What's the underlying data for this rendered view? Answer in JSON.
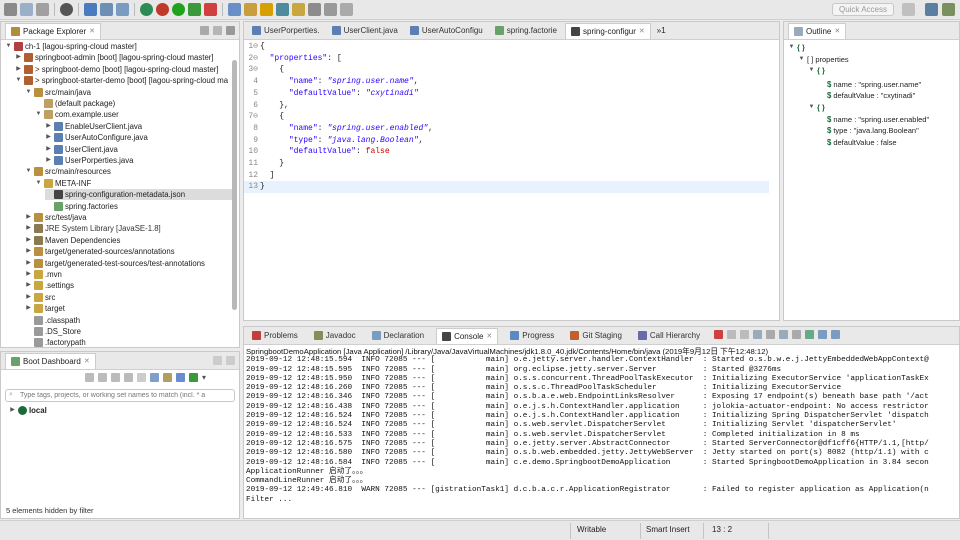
{
  "toolbar": {
    "quick_access": "Quick Access"
  },
  "package_explorer": {
    "title": "Package Explorer",
    "items": [
      {
        "label": "ch-1 [lagou-spring-cloud master]"
      },
      {
        "label": "springboot-admin [boot] [lagou-spring-cloud master]"
      },
      {
        "label": "> springboot-demo [boot] [lagou-spring-cloud master]"
      },
      {
        "label": "> springboot-starter-demo [boot] [lagou-spring-cloud ma"
      },
      {
        "label": "src/main/java"
      },
      {
        "label": "(default package)"
      },
      {
        "label": "com.example.user"
      },
      {
        "label": "EnableUserClient.java"
      },
      {
        "label": "UserAutoConfigure.java"
      },
      {
        "label": "UserClient.java"
      },
      {
        "label": "UserPorperties.java"
      },
      {
        "label": "src/main/resources"
      },
      {
        "label": "META-INF"
      },
      {
        "label": "spring-configuration-metadata.json"
      },
      {
        "label": "spring.factories"
      },
      {
        "label": "src/test/java"
      },
      {
        "label": "JRE System Library [JavaSE-1.8]"
      },
      {
        "label": "Maven Dependencies"
      },
      {
        "label": "target/generated-sources/annotations"
      },
      {
        "label": "target/generated-test-sources/test-annotations"
      },
      {
        "label": ".mvn"
      },
      {
        "label": ".settings"
      },
      {
        "label": "src"
      },
      {
        "label": "target"
      },
      {
        "label": ".classpath"
      },
      {
        "label": ".DS_Store"
      },
      {
        "label": ".factorypath"
      }
    ]
  },
  "boot_dashboard": {
    "title": "Boot Dashboard",
    "search_placeholder": "Type tags, projects, or working set names to match (incl. * a",
    "local_label": "local",
    "footer": "5 elements hidden by filter"
  },
  "editor": {
    "tabs": [
      {
        "label": "UserPorperties."
      },
      {
        "label": "UserClient.java"
      },
      {
        "label": "UserAutoConfigu"
      },
      {
        "label": "spring.factorie"
      },
      {
        "label": "spring-configur"
      }
    ],
    "overflow": "»1",
    "lines": [
      {
        "n": "1⊖",
        "text": "{"
      },
      {
        "n": "2⊖",
        "text": "  \"properties\": ["
      },
      {
        "n": "3⊖",
        "text": "    {"
      },
      {
        "n": "4",
        "text": "      \"name\": \"spring.user.name\","
      },
      {
        "n": "5",
        "text": "      \"defaultValue\": \"cxytinadi\""
      },
      {
        "n": "6",
        "text": "    },"
      },
      {
        "n": "7⊖",
        "text": "    {"
      },
      {
        "n": "8",
        "text": "      \"name\": \"spring.user.enabled\","
      },
      {
        "n": "9",
        "text": "      \"type\": \"java.lang.Boolean\","
      },
      {
        "n": "10",
        "text": "      \"defaultValue\": false"
      },
      {
        "n": "11",
        "text": "    }"
      },
      {
        "n": "12",
        "text": "  ]"
      },
      {
        "n": "13",
        "text": "}"
      }
    ]
  },
  "outline": {
    "title": "Outline",
    "items": [
      {
        "label": "{ }"
      },
      {
        "label": "[ ] properties"
      },
      {
        "label": "{ }"
      },
      {
        "label": "name : \"spring.user.name\""
      },
      {
        "label": "defaultValue : \"cxytinadi\""
      },
      {
        "label": "{ }"
      },
      {
        "label": "name : \"spring.user.enabled\""
      },
      {
        "label": "type : \"java.lang.Boolean\""
      },
      {
        "label": "defaultValue : false"
      }
    ]
  },
  "console": {
    "tabs": [
      {
        "label": "Problems"
      },
      {
        "label": "Javadoc"
      },
      {
        "label": "Declaration"
      },
      {
        "label": "Console"
      },
      {
        "label": "Progress"
      },
      {
        "label": "Git Staging"
      },
      {
        "label": "Call Hierarchy"
      }
    ],
    "header": "SpringbootDemoApplication [Java Application] /Library/Java/JavaVirtualMachines/jdk1.8.0_40.jdk/Contents/Home/bin/java (2019年9月12日 下午12:48:12)",
    "lines": [
      "2019-09-12 12:48:15.594  INFO 72085 --- [           main] o.e.jetty.server.handler.ContextHandler  : Started o.s.b.w.e.j.JettyEmbeddedWebAppContext@",
      "2019-09-12 12:48:15.595  INFO 72085 --- [           main] org.eclipse.jetty.server.Server          : Started @3276ms",
      "2019-09-12 12:48:15.950  INFO 72085 --- [           main] o.s.s.concurrent.ThreadPoolTaskExecutor  : Initializing ExecutorService 'applicationTaskEx",
      "2019-09-12 12:48:16.260  INFO 72085 --- [           main] o.s.s.c.ThreadPoolTaskScheduler          : Initializing ExecutorService",
      "2019-09-12 12:48:16.346  INFO 72085 --- [           main] o.s.b.a.e.web.EndpointLinksResolver      : Exposing 17 endpoint(s) beneath base path '/act",
      "2019-09-12 12:48:16.438  INFO 72085 --- [           main] o.e.j.s.h.ContextHandler.application     : jolokia-actuator-endpoint: No access restrictor",
      "2019-09-12 12:48:16.524  INFO 72085 --- [           main] o.e.j.s.h.ContextHandler.application     : Initializing Spring DispatcherServlet 'dispatch",
      "2019-09-12 12:48:16.524  INFO 72085 --- [           main] o.s.web.servlet.DispatcherServlet        : Initializing Servlet 'dispatcherServlet'",
      "2019-09-12 12:48:16.533  INFO 72085 --- [           main] o.s.web.servlet.DispatcherServlet        : Completed initialization in 8 ms",
      "2019-09-12 12:48:16.575  INFO 72085 --- [           main] o.e.jetty.server.AbstractConnector       : Started ServerConnector@df1cff6{HTTP/1.1,[http/",
      "2019-09-12 12:48:16.580  INFO 72085 --- [           main] o.s.b.web.embedded.jetty.JettyWebServer  : Jetty started on port(s) 8082 (http/1.1) with c",
      "2019-09-12 12:48:16.584  INFO 72085 --- [           main] c.e.demo.SpringbootDemoApplication       : Started SpringbootDemoApplication in 3.84 secon",
      "ApplicationRunner 启动了。。。",
      "CommandLineRunner 启动了。。。",
      "2019-09-12 12:49:46.810  WARN 72085 --- [gistrationTask1] d.c.b.a.c.r.ApplicationRegistrator       : Failed to register application as Application(n",
      "Filter ..."
    ]
  },
  "status": {
    "writable": "Writable",
    "insert_mode": "Smart Insert",
    "position": "13 : 2"
  }
}
